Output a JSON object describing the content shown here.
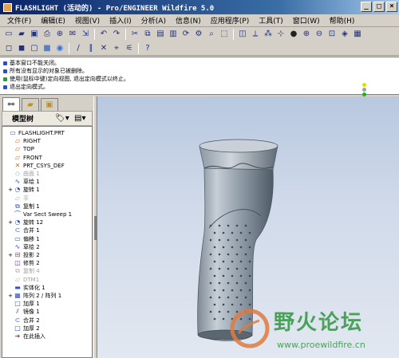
{
  "window": {
    "title": "FLASHLIGHT (活动的) - Pro/ENGINEER Wildfire 5.0"
  },
  "menu": [
    "文件(F)",
    "编辑(E)",
    "视图(V)",
    "插入(I)",
    "分析(A)",
    "信息(N)",
    "应用程序(P)",
    "工具(T)",
    "窗口(W)",
    "帮助(H)"
  ],
  "messages": [
    {
      "text": "基本窗口不能关闭。",
      "color": "#3050c0"
    },
    {
      "text": "所有没有显示的对象已被删除。",
      "color": "#3050c0"
    },
    {
      "text": "使用(鼠标中键)定向视图, 退出定向模式以终止。",
      "color": "#2a9a3a"
    },
    {
      "text": "退出定向模式。",
      "color": "#3050c0"
    }
  ],
  "model_tree": {
    "header": "模型树",
    "items": [
      {
        "label": "FLASHLIGHT.PRT",
        "icon": "part-icon",
        "indent": 0,
        "expand": "",
        "dim": false
      },
      {
        "label": "RIGHT",
        "icon": "datum-plane-icon",
        "indent": 1,
        "expand": "",
        "dim": false
      },
      {
        "label": "TOP",
        "icon": "datum-plane-icon",
        "indent": 1,
        "expand": "",
        "dim": false
      },
      {
        "label": "FRONT",
        "icon": "datum-plane-icon",
        "indent": 1,
        "expand": "",
        "dim": false
      },
      {
        "label": "PRT_CSYS_DEF",
        "icon": "csys-icon",
        "indent": 1,
        "expand": "",
        "dim": false
      },
      {
        "label": "曲面 1",
        "icon": "surface-icon",
        "indent": 1,
        "expand": "",
        "dim": true
      },
      {
        "label": "草绘 1",
        "icon": "sketch-icon",
        "indent": 1,
        "expand": "",
        "dim": false
      },
      {
        "label": "旋转 1",
        "icon": "revolve-icon",
        "indent": 1,
        "expand": "+",
        "dim": false
      },
      {
        "label": "平",
        "icon": "datum-plane-icon",
        "indent": 1,
        "expand": "",
        "dim": true
      },
      {
        "label": "复制 1",
        "icon": "copy-icon",
        "indent": 1,
        "expand": "",
        "dim": false
      },
      {
        "label": "Var Sect Sweep 1",
        "icon": "sweep-icon",
        "indent": 1,
        "expand": "",
        "dim": false
      },
      {
        "label": "旋转 12",
        "icon": "revolve-icon",
        "indent": 1,
        "expand": "+",
        "dim": false
      },
      {
        "label": "合并 1",
        "icon": "merge-icon",
        "indent": 1,
        "expand": "",
        "dim": false
      },
      {
        "label": "偏移 1",
        "icon": "offset-icon",
        "indent": 1,
        "expand": "",
        "dim": false
      },
      {
        "label": "草绘 2",
        "icon": "sketch-icon",
        "indent": 1,
        "expand": "",
        "dim": false
      },
      {
        "label": "投影 2",
        "icon": "project-icon",
        "indent": 1,
        "expand": "+",
        "dim": false
      },
      {
        "label": "修剪 2",
        "icon": "trim-icon",
        "indent": 1,
        "expand": "",
        "dim": false
      },
      {
        "label": "复制 4",
        "icon": "copy-icon",
        "indent": 1,
        "expand": "",
        "dim": true
      },
      {
        "label": "DTM1",
        "icon": "datum-plane-icon",
        "indent": 1,
        "expand": "",
        "dim": true
      },
      {
        "label": "实体化 1",
        "icon": "solidify-icon",
        "indent": 1,
        "expand": "",
        "dim": false
      },
      {
        "label": "阵列 2 / 阵列 1",
        "icon": "pattern-icon",
        "indent": 1,
        "expand": "+",
        "dim": false
      },
      {
        "label": "加厚 1",
        "icon": "thicken-icon",
        "indent": 1,
        "expand": "",
        "dim": false
      },
      {
        "label": "镜像 1",
        "icon": "mirror-icon",
        "indent": 1,
        "expand": "",
        "dim": false
      },
      {
        "label": "合并 2",
        "icon": "merge-icon",
        "indent": 1,
        "expand": "",
        "dim": false
      },
      {
        "label": "加厚 2",
        "icon": "thicken-icon",
        "indent": 1,
        "expand": "",
        "dim": false
      },
      {
        "label": "在此插入",
        "icon": "insert-here-icon",
        "indent": 1,
        "expand": "",
        "dim": false
      }
    ]
  },
  "watermark": {
    "title": "野火论坛",
    "url": "www.proewildfire.cn"
  }
}
